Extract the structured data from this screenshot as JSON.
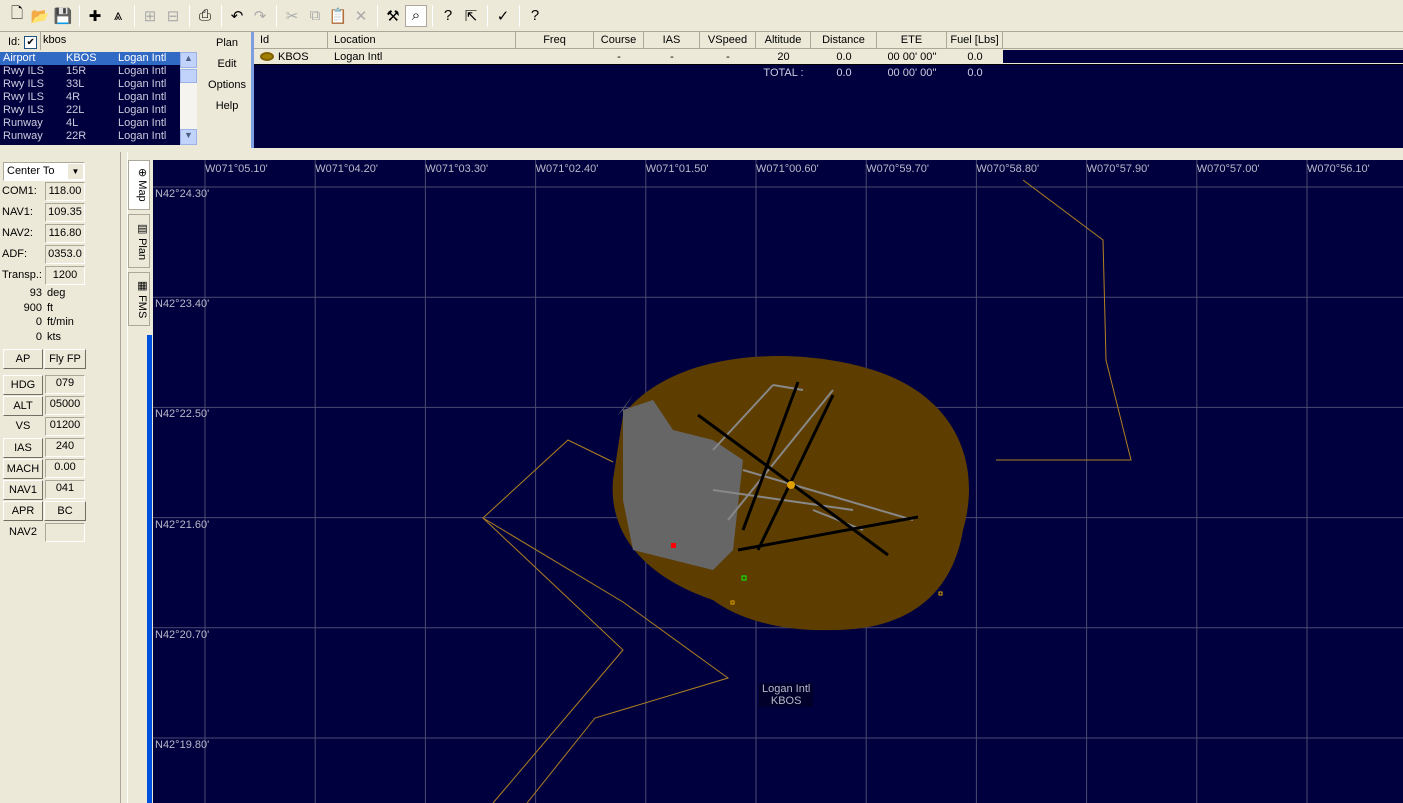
{
  "toolbar": {
    "icons": [
      "new-file-icon",
      "open-folder-icon",
      "save-icon",
      "add-aircraft-icon",
      "flight-path-icon",
      "add-waypoint-icon",
      "remove-waypoint-icon",
      "print-icon",
      "undo-icon",
      "redo-icon",
      "cut-icon",
      "copy-icon",
      "paste-icon",
      "delete-icon",
      "hammer-icon",
      "map-search-icon",
      "help-context-icon",
      "whats-this-icon",
      "checklist-icon",
      "about-icon"
    ]
  },
  "search": {
    "label": "Id:",
    "checked": true,
    "value": "kbos"
  },
  "list": [
    {
      "type": "Airport",
      "id": "KBOS",
      "name": "Logan Intl"
    },
    {
      "type": "Rwy ILS",
      "id": "15R",
      "name": "Logan Intl"
    },
    {
      "type": "Rwy ILS",
      "id": "33L",
      "name": "Logan Intl"
    },
    {
      "type": "Rwy ILS",
      "id": "4R",
      "name": "Logan Intl"
    },
    {
      "type": "Rwy ILS",
      "id": "22L",
      "name": "Logan Intl"
    },
    {
      "type": "Runway",
      "id": "4L",
      "name": "Logan Intl"
    },
    {
      "type": "Runway",
      "id": "22R",
      "name": "Logan Intl"
    }
  ],
  "menu": [
    "Plan",
    "Edit",
    "Options",
    "Help"
  ],
  "plan": {
    "columns": [
      "Id",
      "Location",
      "Freq",
      "Course",
      "IAS",
      "VSpeed",
      "Altitude",
      "Distance",
      "ETE",
      "Fuel [Lbs]"
    ],
    "rows": [
      {
        "id": "KBOS",
        "location": "Logan Intl",
        "freq": "",
        "course": "-",
        "ias": "-",
        "vspeed": "-",
        "altitude": "20",
        "distance": "0.0",
        "ete": "00 00' 00''",
        "fuel": "0.0"
      }
    ],
    "total": {
      "label": "TOTAL :",
      "distance": "0.0",
      "ete": "00 00' 00''",
      "fuel": "0.0"
    }
  },
  "left": {
    "center": "Center To",
    "radios": [
      {
        "label": "COM1:",
        "value": "118.00"
      },
      {
        "label": "NAV1:",
        "value": "109.35"
      },
      {
        "label": "NAV2:",
        "value": "116.80"
      },
      {
        "label": "ADF:",
        "value": "0353.0"
      },
      {
        "label": "Transp.:",
        "value": "1200"
      }
    ],
    "status": [
      {
        "v": "93",
        "u": "deg"
      },
      {
        "v": "900",
        "u": "ft"
      },
      {
        "v": "0",
        "u": "ft/min"
      },
      {
        "v": "0",
        "u": "kts"
      }
    ],
    "ap": "AP",
    "flyfp": "Fly FP",
    "autopilot": [
      {
        "label": "HDG",
        "value": "079",
        "button": true
      },
      {
        "label": "ALT",
        "value": "05000",
        "button": true
      },
      {
        "label": "VS",
        "value": "01200",
        "button": false
      },
      {
        "label": "IAS",
        "value": "240",
        "button": true
      },
      {
        "label": "MACH",
        "value": "0.00",
        "button": true
      },
      {
        "label": "NAV1",
        "value": "041",
        "button": true
      }
    ],
    "apr": "APR",
    "bc": "BC",
    "nav2": "NAV2",
    "nav2value": ""
  },
  "tabs": [
    "Map",
    "Plan",
    "FMS"
  ],
  "map": {
    "lon": [
      "W071°05.10'",
      "W071°04.20'",
      "W071°03.30'",
      "W071°02.40'",
      "W071°01.50'",
      "W071°00.60'",
      "W070°59.70'",
      "W070°58.80'",
      "W070°57.90'",
      "W070°57.00'",
      "W070°56.10'"
    ],
    "lat": [
      "N42°24.30'",
      "N42°23.40'",
      "N42°22.50'",
      "N42°21.60'",
      "N42°20.70'",
      "N42°19.80'"
    ],
    "airport_name": "Logan Intl",
    "airport_id": "KBOS",
    "colors": {
      "background": "#00003f",
      "grid": "#4a4a70",
      "airport": "#5e3e00",
      "boundary": "#b08020"
    }
  }
}
